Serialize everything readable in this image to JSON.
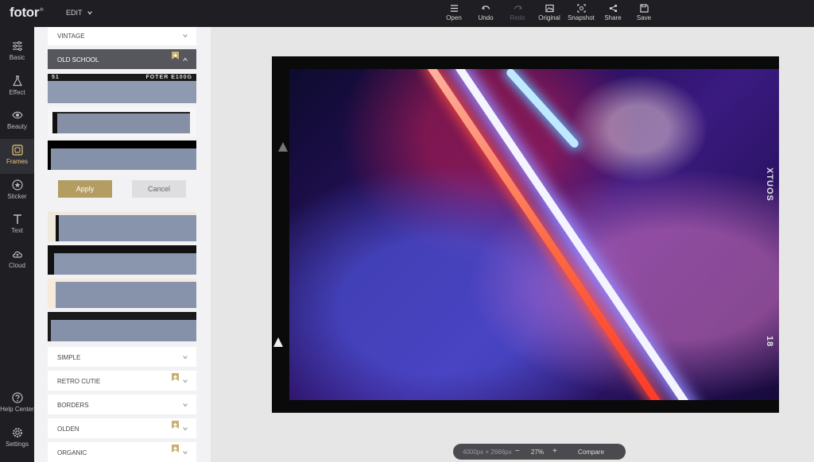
{
  "app": {
    "logo": "fotor",
    "logo_mark": "®",
    "menu_label": "EDIT"
  },
  "toolbar": [
    {
      "key": "open",
      "label": "Open",
      "icon": "menu-icon"
    },
    {
      "key": "undo",
      "label": "Undo",
      "icon": "undo-icon"
    },
    {
      "key": "redo",
      "label": "Redo",
      "icon": "redo-icon",
      "disabled": true
    },
    {
      "key": "original",
      "label": "Original",
      "icon": "image-icon"
    },
    {
      "key": "snapshot",
      "label": "Snapshot",
      "icon": "camera-icon"
    },
    {
      "key": "share",
      "label": "Share",
      "icon": "share-icon"
    },
    {
      "key": "save",
      "label": "Save",
      "icon": "save-icon"
    }
  ],
  "nav": [
    {
      "label": "Basic",
      "icon": "sliders-icon"
    },
    {
      "label": "Effect",
      "icon": "flask-icon"
    },
    {
      "label": "Beauty",
      "icon": "eye-icon"
    },
    {
      "label": "Frames",
      "icon": "frame-icon",
      "active": true
    },
    {
      "label": "Sticker",
      "icon": "sticker-icon"
    },
    {
      "label": "Text",
      "icon": "text-icon"
    },
    {
      "label": "Cloud",
      "icon": "cloud-icon"
    }
  ],
  "nav_bottom": [
    {
      "label": "Help Center",
      "icon": "help-icon"
    },
    {
      "label": "Settings",
      "icon": "gear-icon"
    }
  ],
  "panel": {
    "open_category": "OLD SCHOOL",
    "thumb_text_left": "51",
    "thumb_text_right": "FOTER E100G",
    "apply_label": "Apply",
    "cancel_label": "Cancel",
    "categories_top": [
      {
        "label": "VINTAGE"
      }
    ],
    "categories_bottom": [
      {
        "label": "SIMPLE",
        "premium": false
      },
      {
        "label": "RETRO CUTIE",
        "premium": true
      },
      {
        "label": "BORDERS",
        "premium": false
      },
      {
        "label": "OLDEN",
        "premium": true
      },
      {
        "label": "ORGANIC",
        "premium": true
      }
    ]
  },
  "canvas": {
    "frame_text_top": "XTUOS",
    "frame_text_bottom": "18"
  },
  "status": {
    "dimensions": "4000px × 2666px",
    "zoom_out": "−",
    "zoom": "27%",
    "zoom_in": "+",
    "compare_label": "Compare"
  },
  "colors": {
    "accent": "#b39d63",
    "dark": "#1e1e23",
    "active_nav": "#e8c87c"
  }
}
